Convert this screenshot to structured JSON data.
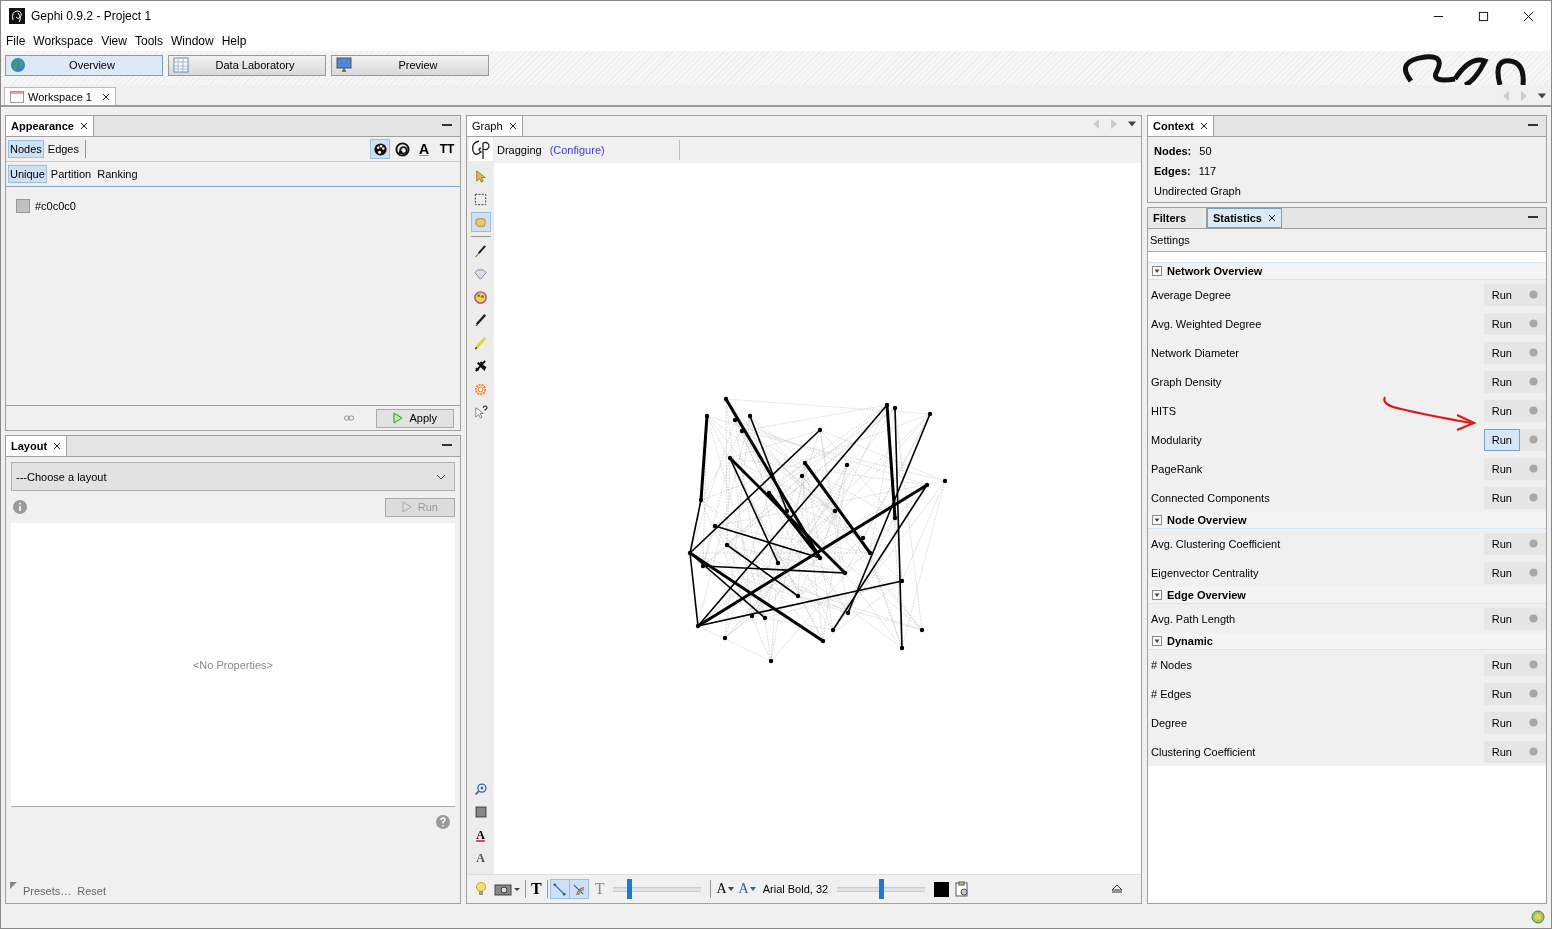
{
  "window": {
    "title": "Gephi 0.9.2 - Project 1"
  },
  "menu": [
    "File",
    "Workspace",
    "View",
    "Tools",
    "Window",
    "Help"
  ],
  "perspectives": [
    {
      "label": "Overview",
      "kind": "globe",
      "selected": true
    },
    {
      "label": "Data Laboratory",
      "kind": "table",
      "selected": false
    },
    {
      "label": "Preview",
      "kind": "monitor",
      "selected": false
    }
  ],
  "workspace_tabs": [
    {
      "label": "Workspace 1",
      "selected": true
    }
  ],
  "appearance": {
    "title": "Appearance",
    "targets": [
      {
        "label": "Nodes",
        "selected": true
      },
      {
        "label": "Edges",
        "selected": false
      }
    ],
    "attributes": [
      {
        "kind": "color",
        "selected": true
      },
      {
        "kind": "size",
        "selected": false
      },
      {
        "kind": "label-color",
        "glyph": "A",
        "selected": false
      },
      {
        "kind": "label-size",
        "glyph": "TT",
        "selected": false
      }
    ],
    "modes": [
      {
        "label": "Unique",
        "selected": true
      },
      {
        "label": "Partition",
        "selected": false
      },
      {
        "label": "Ranking",
        "selected": false
      }
    ],
    "color": "#c0c0c0",
    "color_label": "#c0c0c0",
    "apply": "Apply"
  },
  "layout": {
    "title": "Layout",
    "select": "---Choose a layout",
    "run": "Run",
    "run_disabled": true,
    "empty": "<No Properties>",
    "presets": "Presets…",
    "reset": "Reset"
  },
  "graph": {
    "tab": "Graph",
    "mode": "Dragging",
    "configure": "(Configure)",
    "tools": [
      {
        "kind": "pointer",
        "selected": false
      },
      {
        "kind": "rect-select",
        "selected": false
      },
      {
        "kind": "hand",
        "selected": true
      },
      {
        "kind": "separator"
      },
      {
        "kind": "brush",
        "selected": false
      },
      {
        "kind": "diamond",
        "selected": false
      },
      {
        "kind": "palette",
        "selected": false
      },
      {
        "kind": "pencil",
        "selected": false
      },
      {
        "kind": "highlighter",
        "selected": false
      },
      {
        "kind": "airplane",
        "selected": false
      },
      {
        "kind": "sun",
        "selected": false
      },
      {
        "kind": "help-pointer",
        "selected": false
      }
    ],
    "bottom_tools": [
      {
        "kind": "zoom"
      },
      {
        "kind": "square"
      },
      {
        "kind": "label-color",
        "glyph": "A"
      },
      {
        "kind": "label-size",
        "glyph": "A"
      }
    ],
    "toolbar": {
      "show_labels": "T",
      "toggles": [
        {
          "kind": "edges",
          "selected": true
        },
        {
          "kind": "edge-color",
          "selected": true
        }
      ],
      "label_outline": "T",
      "edge_scale": {
        "level": 0.18
      },
      "font_glyph": "A",
      "font_size_glyph": "A",
      "font": "Arial Bold, 32",
      "label_scale": {
        "level": 0.5
      }
    }
  },
  "context": {
    "title": "Context",
    "stats": [
      {
        "label": "Nodes:",
        "value": "50"
      },
      {
        "label": "Edges:",
        "value": "117"
      }
    ],
    "graph_type": "Undirected Graph"
  },
  "statistics": {
    "tabs": [
      {
        "label": "Filters",
        "selected": false
      },
      {
        "label": "Statistics",
        "selected": true
      }
    ],
    "settings": "Settings",
    "groups": [
      {
        "title": "Network Overview",
        "expanded": true,
        "items": [
          {
            "name": "Average Degree",
            "run": "Run",
            "highlighted": false
          },
          {
            "name": "Avg. Weighted Degree",
            "run": "Run",
            "highlighted": false
          },
          {
            "name": "Network Diameter",
            "run": "Run",
            "highlighted": false
          },
          {
            "name": "Graph Density",
            "run": "Run",
            "highlighted": false
          },
          {
            "name": "HITS",
            "run": "Run",
            "highlighted": false
          },
          {
            "name": "Modularity",
            "run": "Run",
            "highlighted": true
          },
          {
            "name": "PageRank",
            "run": "Run",
            "highlighted": false
          },
          {
            "name": "Connected Components",
            "run": "Run",
            "highlighted": false
          }
        ]
      },
      {
        "title": "Node Overview",
        "expanded": true,
        "items": [
          {
            "name": "Avg. Clustering Coefficient",
            "run": "Run",
            "highlighted": false
          },
          {
            "name": "Eigenvector Centrality",
            "run": "Run",
            "highlighted": false
          }
        ]
      },
      {
        "title": "Edge Overview",
        "expanded": true,
        "items": [
          {
            "name": "Avg. Path Length",
            "run": "Run",
            "highlighted": false
          }
        ]
      },
      {
        "title": "Dynamic",
        "expanded": true,
        "items": [
          {
            "name": "# Nodes",
            "run": "Run",
            "highlighted": false
          },
          {
            "name": "# Edges",
            "run": "Run",
            "highlighted": false
          },
          {
            "name": "Degree",
            "run": "Run",
            "highlighted": false
          },
          {
            "name": "Clustering Coefficient",
            "run": "Run",
            "highlighted": false
          }
        ]
      }
    ]
  }
}
